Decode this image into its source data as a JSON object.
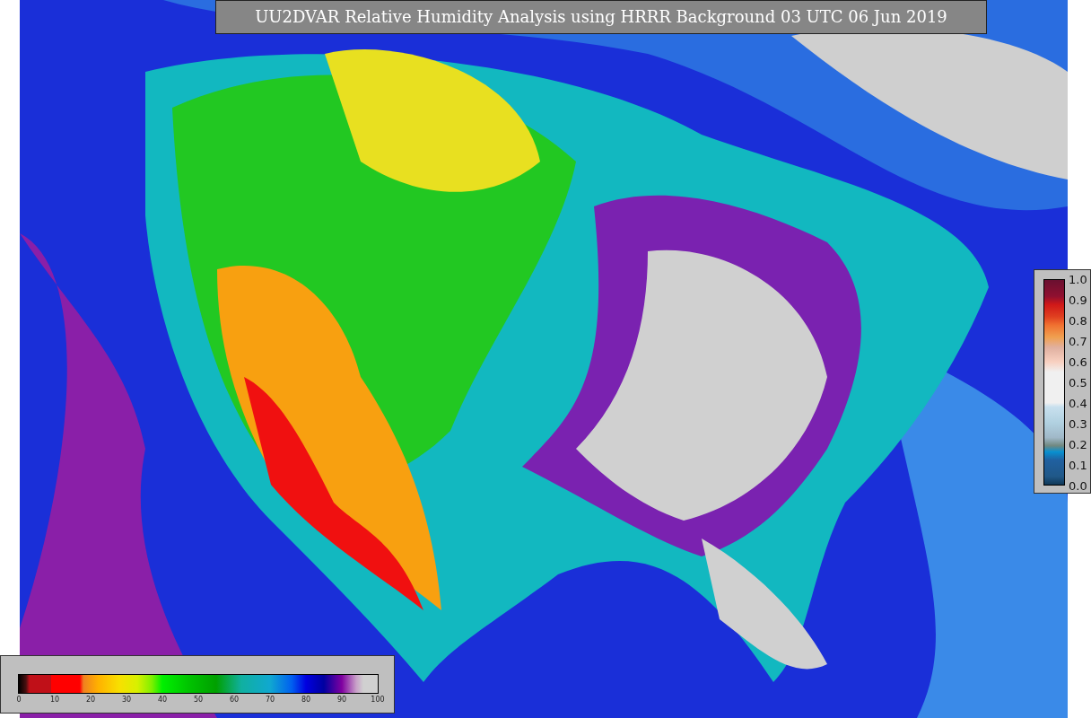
{
  "title": "UU2DVAR Relative Humidity Analysis using HRRR Background 03 UTC 06 Jun 2019",
  "humidity_colorbar": {
    "ticks": [
      "0",
      "10",
      "20",
      "30",
      "40",
      "50",
      "60",
      "70",
      "80",
      "90",
      "100"
    ]
  },
  "weight_colorbar": {
    "ticks": [
      "1.0",
      "0.9",
      "0.8",
      "0.7",
      "0.6",
      "0.5",
      "0.4",
      "0.3",
      "0.2",
      "0.1",
      "0.0"
    ]
  }
}
